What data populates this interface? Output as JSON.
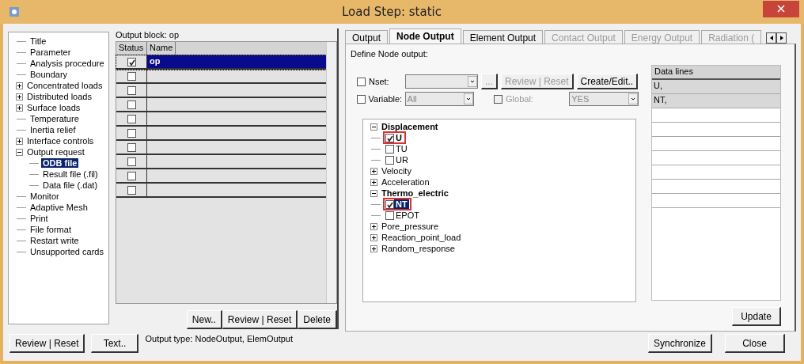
{
  "window": {
    "title": "Load Step: static"
  },
  "nav_tree": [
    {
      "label": "Title",
      "selected": false
    },
    {
      "label": "Parameter",
      "selected": false
    },
    {
      "label": "Analysis procedure",
      "selected": false
    },
    {
      "label": "Boundary",
      "selected": false
    },
    {
      "label": "Concentrated loads",
      "selected": false,
      "expanded": false
    },
    {
      "label": "Distributed loads",
      "selected": false,
      "expanded": false
    },
    {
      "label": "Surface loads",
      "selected": false,
      "expanded": false
    },
    {
      "label": "Temperature",
      "selected": false
    },
    {
      "label": "Inertia relief",
      "selected": false
    },
    {
      "label": "Interface controls",
      "selected": false,
      "expanded": false
    },
    {
      "label": "Output request",
      "selected": false,
      "expanded": true,
      "children": [
        {
          "label": "ODB file",
          "selected": true
        },
        {
          "label": "Result file (.fil)",
          "selected": false
        },
        {
          "label": "Data file (.dat)",
          "selected": false
        }
      ]
    },
    {
      "label": "Monitor",
      "selected": false
    },
    {
      "label": "Adaptive Mesh",
      "selected": false
    },
    {
      "label": "Print",
      "selected": false
    },
    {
      "label": "File format",
      "selected": false
    },
    {
      "label": "Restart write",
      "selected": false
    },
    {
      "label": "Unsupported cards",
      "selected": false
    }
  ],
  "output_block": {
    "label": "Output block: op",
    "columns": [
      "Status",
      "Name"
    ],
    "rows": [
      {
        "checked": true,
        "selected": true,
        "name": "op"
      },
      {
        "checked": false,
        "selected": false
      },
      {
        "checked": false,
        "selected": false
      },
      {
        "checked": false,
        "selected": false
      },
      {
        "checked": false,
        "selected": false
      },
      {
        "checked": false,
        "selected": false
      },
      {
        "checked": false,
        "selected": false
      },
      {
        "checked": false,
        "selected": false
      },
      {
        "checked": false,
        "selected": false
      },
      {
        "checked": false,
        "selected": false
      }
    ],
    "buttons": [
      "New..",
      "Review | Reset",
      "Delete"
    ]
  },
  "tabs": [
    {
      "label": "Output",
      "selected": false,
      "disabled": false
    },
    {
      "label": "Node Output",
      "selected": true,
      "disabled": false
    },
    {
      "label": "Element Output",
      "selected": false,
      "disabled": false
    },
    {
      "label": "Contact Output",
      "selected": false,
      "disabled": true
    },
    {
      "label": "Energy Output",
      "selected": false,
      "disabled": true
    },
    {
      "label": "Radiation (",
      "selected": false,
      "disabled": true
    }
  ],
  "node_output": {
    "heading": "Define Node output:",
    "nset": {
      "label": "Nset:",
      "checked": false,
      "browse": "...",
      "review": "Review | Reset",
      "create": "Create/Edit.."
    },
    "variable": {
      "label": "Variable:",
      "checked": false,
      "value": "All"
    },
    "global": {
      "label": "Global:",
      "checked": false,
      "disabled": true,
      "value": "YES"
    },
    "variables_tree": [
      {
        "label": "Displacement",
        "expanded": true,
        "children": [
          {
            "label": "U",
            "checked": true,
            "selected": false,
            "highlighted": true
          },
          {
            "label": "TU",
            "checked": false,
            "selected": false,
            "highlighted": false
          },
          {
            "label": "UR",
            "checked": false,
            "selected": false,
            "highlighted": false
          }
        ]
      },
      {
        "label": "Velocity",
        "expanded": false
      },
      {
        "label": "Acceleration",
        "expanded": false
      },
      {
        "label": "Thermo_electric",
        "expanded": true,
        "children": [
          {
            "label": "NT",
            "checked": true,
            "selected": true,
            "highlighted": true
          },
          {
            "label": "EPOT",
            "checked": false,
            "selected": false,
            "highlighted": false
          }
        ]
      },
      {
        "label": "Pore_pressure",
        "expanded": false
      },
      {
        "label": "Reaction_point_load",
        "expanded": false
      },
      {
        "label": "Random_response",
        "expanded": false
      }
    ],
    "data_lines": {
      "heading": "Data lines",
      "lines": [
        "U,",
        "NT,"
      ]
    },
    "update": "Update"
  },
  "footer": {
    "left_buttons": [
      "Review | Reset",
      "Text.."
    ],
    "output_type": "Output type:  NodeOutput, ElemOutput",
    "right_buttons": [
      "Synchronize",
      "Close"
    ]
  }
}
